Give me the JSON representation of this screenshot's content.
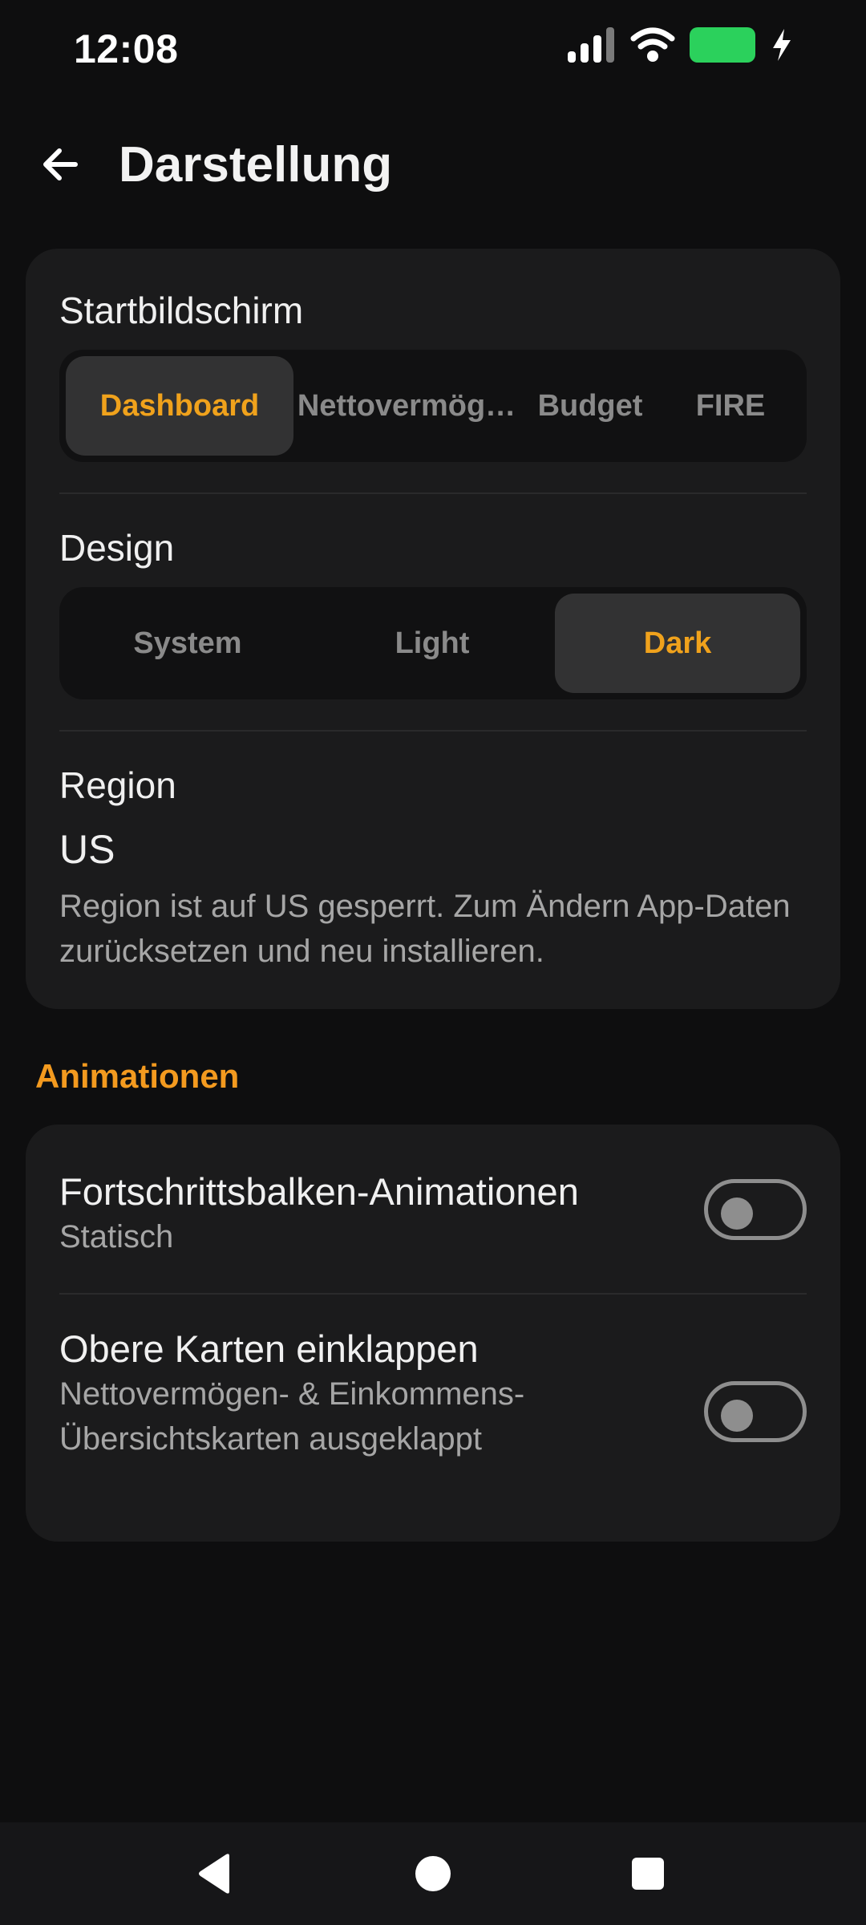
{
  "status_bar": {
    "time": "12:08",
    "icons": [
      "signal-icon",
      "wifi-icon",
      "battery-charging-icon"
    ]
  },
  "app_bar": {
    "title": "Darstellung",
    "back_icon": "arrow-left-icon"
  },
  "appearance": {
    "start_screen": {
      "label": "Startbildschirm",
      "options": [
        "Dashboard",
        "Nettovermög…",
        "Budget",
        "FIRE"
      ],
      "selected": "Dashboard"
    },
    "design": {
      "label": "Design",
      "options": [
        "System",
        "Light",
        "Dark"
      ],
      "selected": "Dark"
    },
    "region": {
      "label": "Region",
      "value": "US",
      "description": "Region ist auf US gesperrt. Zum Ändern App-Daten zurücksetzen und neu installieren."
    }
  },
  "animations": {
    "header": "Animationen",
    "progress_bar": {
      "title": "Fortschrittsbalken-Animationen",
      "subtitle": "Statisch",
      "enabled": false
    },
    "collapse_cards": {
      "title": "Obere Karten einklappen",
      "subtitle": "Nettovermögen- & Einkommens-Übersichtskarten ausgeklappt",
      "enabled": false
    }
  },
  "nav_bar": {
    "icons": [
      "back-triangle-icon",
      "home-circle-icon",
      "recents-square-icon"
    ]
  },
  "colors": {
    "background": "#0e0e0f",
    "card": "#1b1b1c",
    "accent": "#f0a21c",
    "battery": "#2bd15c"
  }
}
